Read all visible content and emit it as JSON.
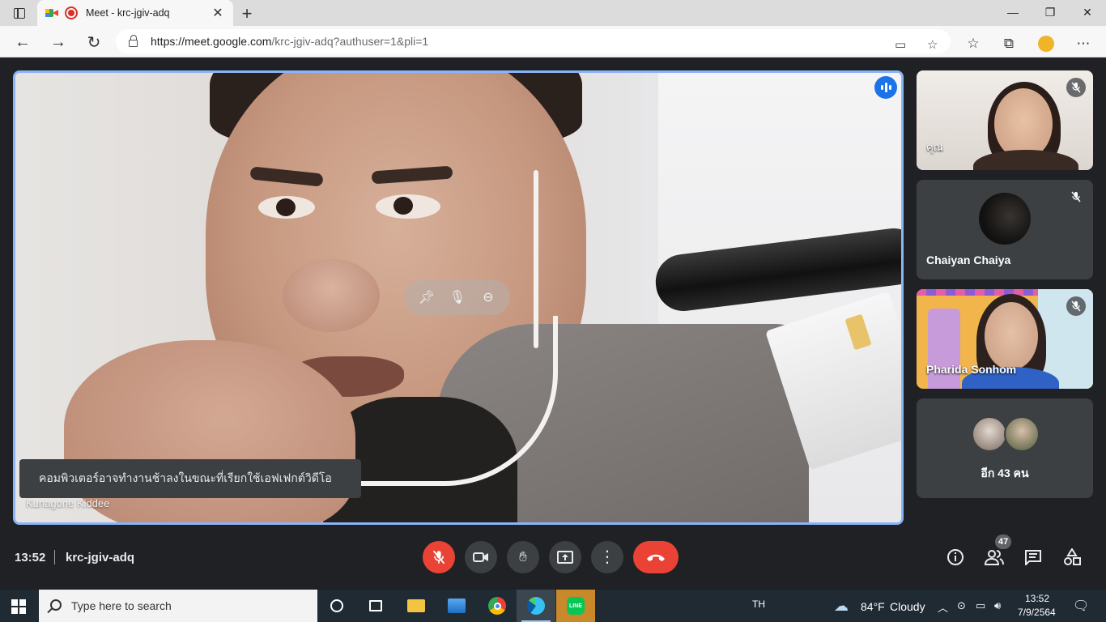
{
  "browser": {
    "tab_title": "Meet - krc-jgiv-adq",
    "url_host": "https://meet.google.com",
    "url_path": "/krc-jgiv-adq?authuser=1&pli=1"
  },
  "stage": {
    "toast_text": "คอมพิวเตอร์อาจทำงานช้าลงในขณะที่เรียกใช้เอฟเฟกต์วิดีโอ",
    "speaker_name": "Kunagone Kiddee"
  },
  "tiles": [
    {
      "name": "คุณ",
      "muted": true
    },
    {
      "name": "Chaiyan Chaiya",
      "muted": true
    },
    {
      "name": "Pharida Sonhom",
      "muted": true
    },
    {
      "name": "อีก 43 คน"
    }
  ],
  "meeting": {
    "time": "13:52",
    "code": "krc-jgiv-adq",
    "participant_count": "47"
  },
  "taskbar": {
    "search_placeholder": "Type here to search",
    "language": "TH",
    "weather_temp": "84°F",
    "weather_desc": "Cloudy",
    "clock_time": "13:52",
    "clock_date": "7/9/2564"
  },
  "colors": {
    "accent": "#8ab4f8",
    "end_call": "#ea4335",
    "meet_bg": "#202124",
    "tile_bg": "#3c4043"
  }
}
